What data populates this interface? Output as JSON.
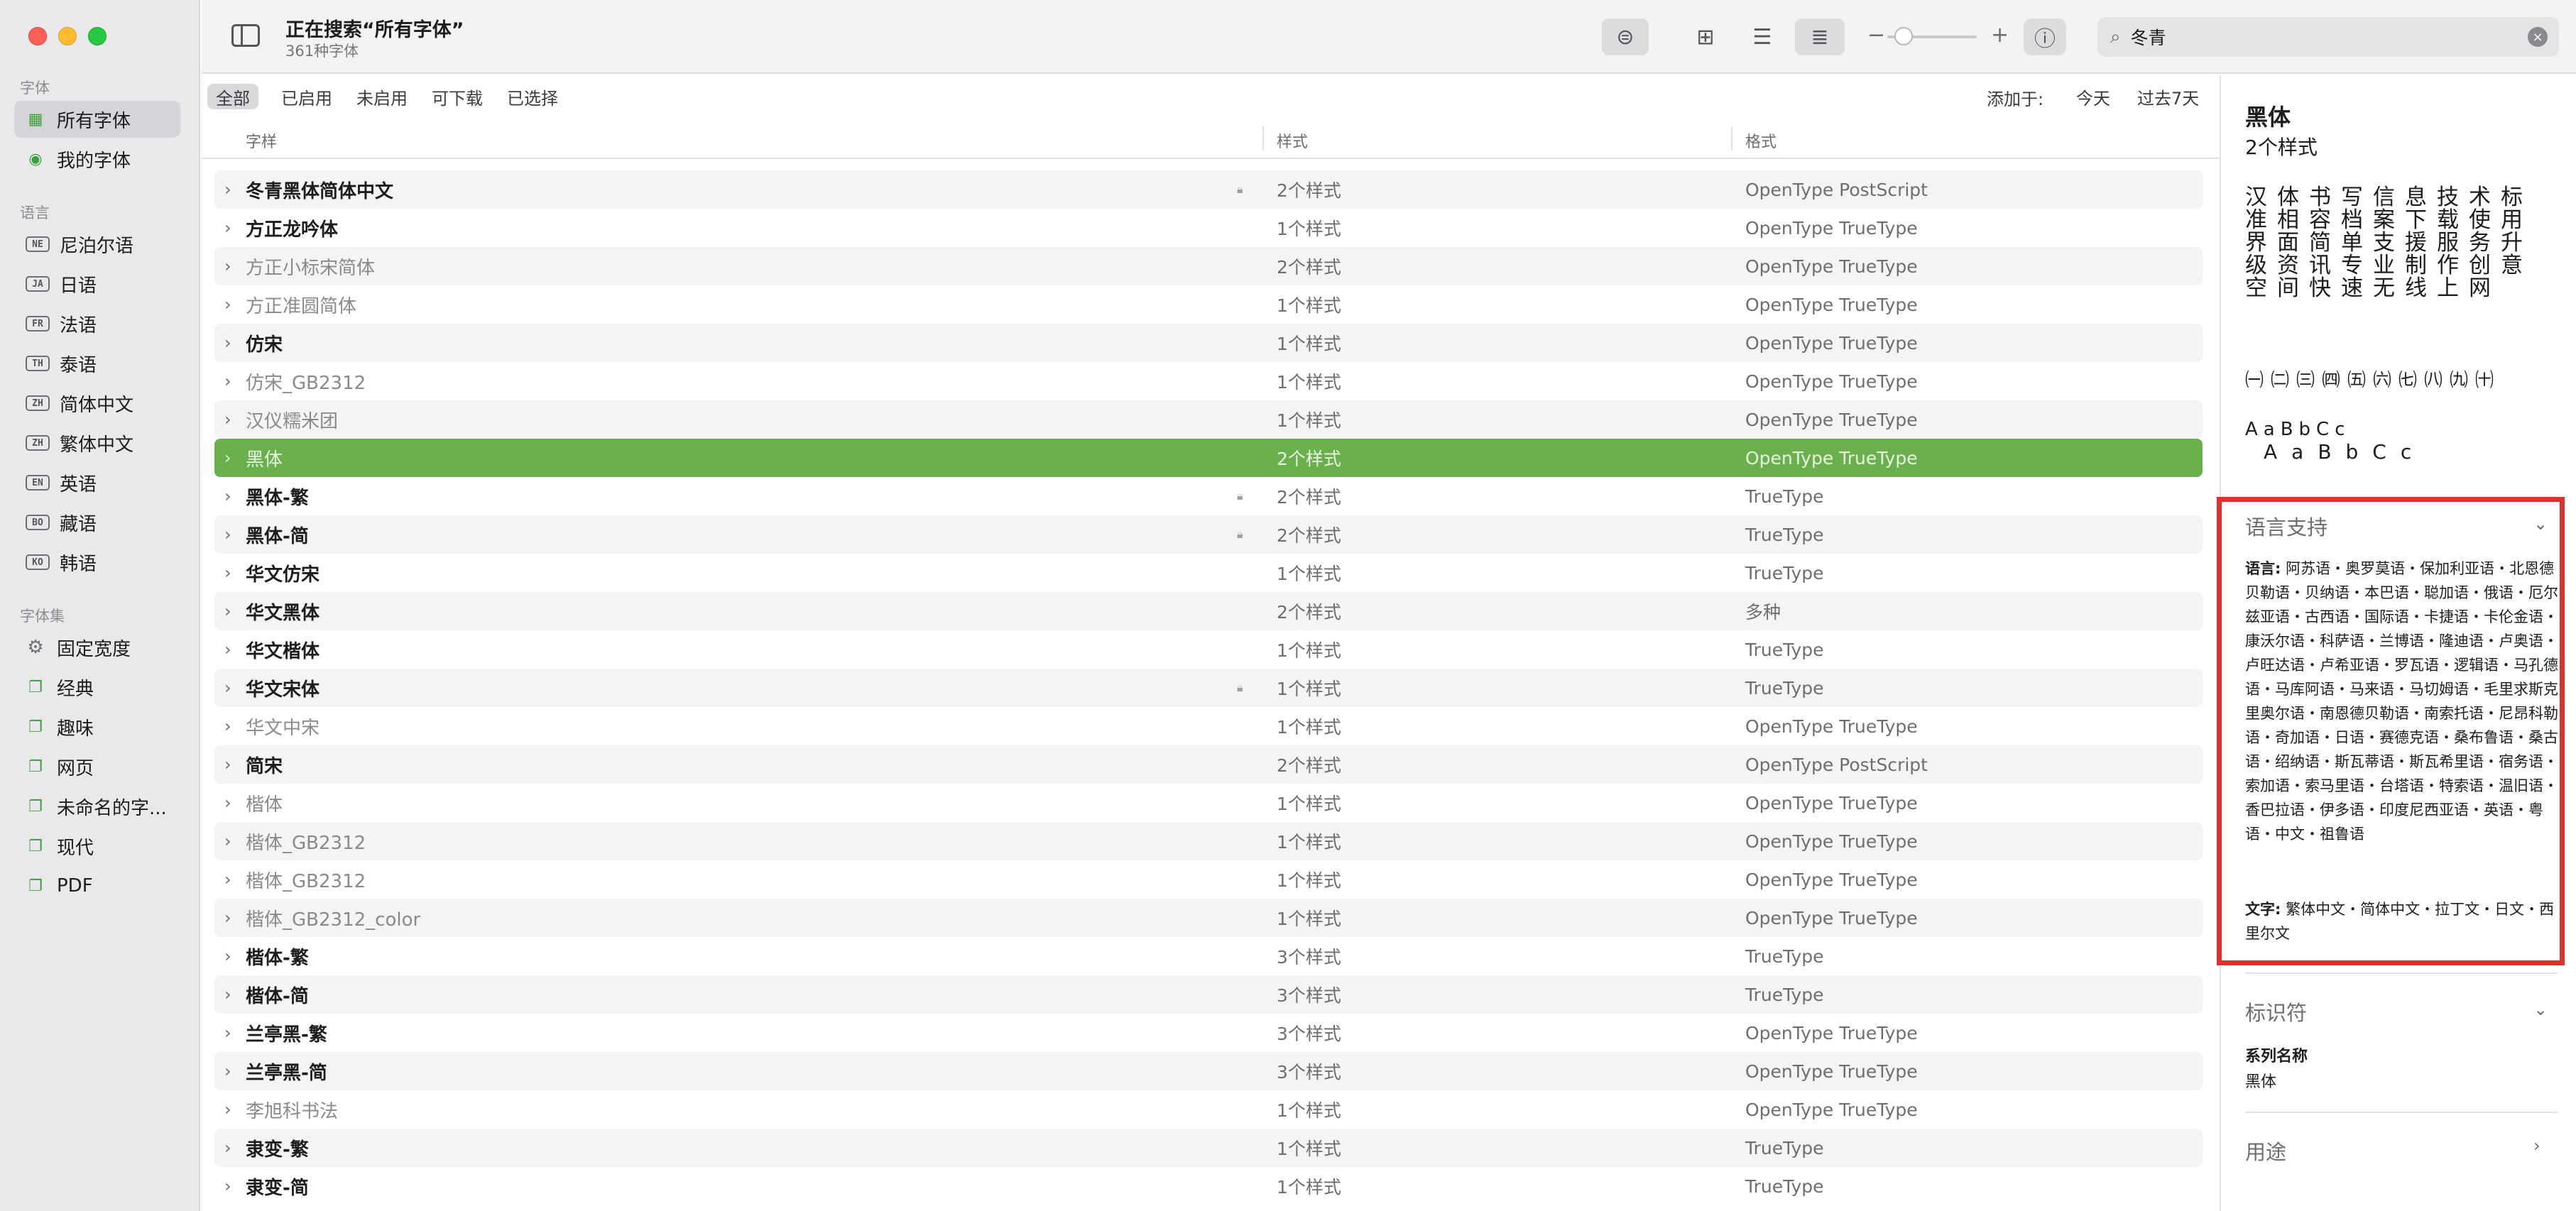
{
  "window": {
    "title": "正在搜索“所有字体”",
    "subtitle": "361种字体"
  },
  "sidebar": {
    "fonts_header": "字体",
    "items": [
      {
        "label": "所有字体",
        "icon": "grid-icon"
      },
      {
        "label": "我的字体",
        "icon": "person-icon"
      }
    ],
    "languages_header": "语言",
    "languages": [
      {
        "code": "NE",
        "label": "尼泊尔语"
      },
      {
        "code": "JA",
        "label": "日语"
      },
      {
        "code": "FR",
        "label": "法语"
      },
      {
        "code": "TH",
        "label": "泰语"
      },
      {
        "code": "ZH",
        "label": "简体中文"
      },
      {
        "code": "ZH",
        "label": "繁体中文"
      },
      {
        "code": "EN",
        "label": "英语"
      },
      {
        "code": "BO",
        "label": "藏语"
      },
      {
        "code": "KO",
        "label": "韩语"
      }
    ],
    "collections_header": "字体集",
    "collections": [
      {
        "label": "固定宽度",
        "icon": "gear-icon"
      },
      {
        "label": "经典",
        "icon": "collection-icon"
      },
      {
        "label": "趣味",
        "icon": "collection-icon"
      },
      {
        "label": "网页",
        "icon": "collection-icon"
      },
      {
        "label": "未命名的字...",
        "icon": "collection-icon"
      },
      {
        "label": "现代",
        "icon": "collection-icon"
      },
      {
        "label": "PDF",
        "icon": "collection-icon"
      }
    ]
  },
  "toolbar": {
    "zoom_minus": "−",
    "zoom_plus": "+"
  },
  "search": {
    "value": "冬青",
    "clear_symbol": "×"
  },
  "filters": {
    "tabs": [
      "全部",
      "已启用",
      "未启用",
      "可下载",
      "已选择"
    ],
    "selected_index": 0,
    "added_label": "添加于:",
    "today": "今天",
    "last7": "过去7天"
  },
  "table": {
    "headers": {
      "name": "字样",
      "styles": "样式",
      "format": "格式"
    },
    "rows": [
      {
        "name": "冬青黑体简体中文",
        "bold": true,
        "lock": true,
        "styles": "2个样式",
        "format": "OpenType PostScript"
      },
      {
        "name": "方正龙吟体",
        "bold": true,
        "lock": false,
        "styles": "1个样式",
        "format": "OpenType TrueType"
      },
      {
        "name": "方正小标宋简体",
        "bold": false,
        "lock": false,
        "styles": "2个样式",
        "format": "OpenType TrueType"
      },
      {
        "name": "方正准圆简体",
        "bold": false,
        "lock": false,
        "styles": "1个样式",
        "format": "OpenType TrueType"
      },
      {
        "name": "仿宋",
        "bold": true,
        "lock": false,
        "styles": "1个样式",
        "format": "OpenType TrueType"
      },
      {
        "name": "仿宋_GB2312",
        "bold": false,
        "lock": false,
        "styles": "1个样式",
        "format": "OpenType TrueType"
      },
      {
        "name": "汉仪糯米团",
        "bold": false,
        "lock": false,
        "styles": "1个样式",
        "format": "OpenType TrueType"
      },
      {
        "name": "黑体",
        "bold": false,
        "lock": false,
        "styles": "2个样式",
        "format": "OpenType TrueType",
        "selected": true
      },
      {
        "name": "黑体-繁",
        "bold": true,
        "lock": true,
        "styles": "2个样式",
        "format": "TrueType"
      },
      {
        "name": "黑体-简",
        "bold": true,
        "lock": true,
        "styles": "2个样式",
        "format": "TrueType"
      },
      {
        "name": "华文仿宋",
        "bold": true,
        "lock": false,
        "styles": "1个样式",
        "format": "TrueType"
      },
      {
        "name": "华文黑体",
        "bold": true,
        "lock": false,
        "styles": "2个样式",
        "format": "多种"
      },
      {
        "name": "华文楷体",
        "bold": true,
        "lock": false,
        "styles": "1个样式",
        "format": "TrueType"
      },
      {
        "name": "华文宋体",
        "bold": true,
        "lock": true,
        "styles": "1个样式",
        "format": "TrueType"
      },
      {
        "name": "华文中宋",
        "bold": false,
        "lock": false,
        "styles": "1个样式",
        "format": "OpenType TrueType"
      },
      {
        "name": "简宋",
        "bold": true,
        "lock": false,
        "styles": "2个样式",
        "format": "OpenType PostScript"
      },
      {
        "name": "楷体",
        "bold": false,
        "lock": false,
        "styles": "1个样式",
        "format": "OpenType TrueType"
      },
      {
        "name": "楷体_GB2312",
        "bold": false,
        "lock": false,
        "styles": "1个样式",
        "format": "OpenType TrueType"
      },
      {
        "name": "楷体_GB2312",
        "bold": false,
        "lock": false,
        "styles": "1个样式",
        "format": "OpenType TrueType"
      },
      {
        "name": "楷体_GB2312_color",
        "bold": false,
        "lock": false,
        "styles": "1个样式",
        "format": "OpenType TrueType"
      },
      {
        "name": "楷体-繁",
        "bold": true,
        "lock": false,
        "styles": "3个样式",
        "format": "TrueType"
      },
      {
        "name": "楷体-简",
        "bold": true,
        "lock": false,
        "styles": "3个样式",
        "format": "TrueType"
      },
      {
        "name": "兰亭黑-繁",
        "bold": true,
        "lock": false,
        "styles": "3个样式",
        "format": "OpenType TrueType"
      },
      {
        "name": "兰亭黑-简",
        "bold": true,
        "lock": false,
        "styles": "3个样式",
        "format": "OpenType TrueType"
      },
      {
        "name": "李旭科书法",
        "bold": false,
        "lock": false,
        "styles": "1个样式",
        "format": "OpenType TrueType"
      },
      {
        "name": "隶变-繁",
        "bold": true,
        "lock": false,
        "styles": "1个样式",
        "format": "TrueType"
      },
      {
        "name": "隶变-简",
        "bold": true,
        "lock": false,
        "styles": "1个样式",
        "format": "TrueType"
      }
    ]
  },
  "panel": {
    "title": "黑体",
    "subtitle": "2个样式",
    "sample_text": "汉体书写信息技术标准相容档案下载使用界面简单支援服务升级资讯专业制作创意空间快速无线上网",
    "sample_numerals": "㈠㈡㈢㈣㈤㈥㈦㈧㈨㈩",
    "sample_latin_1": "AaBbCc",
    "sample_latin_2": "AaBbCc",
    "language_support_title": "语言支持",
    "languages_label": "语言:",
    "languages_value": "阿苏语・奥罗莫语・保加利亚语・北恩德贝勒语・贝纳语・本巴语・聪加语・俄语・厄尔兹亚语・古西语・国际语・卡捷语・卡伦金语・康沃尔语・科萨语・兰博语・隆迪语・卢奥语・卢旺达语・卢希亚语・罗瓦语・逻辑语・马孔德语・马库阿语・马来语・马切姆语・毛里求斯克里奥尔语・南恩德贝勒语・南索托语・尼昂科勒语・奇加语・日语・赛德克语・桑布鲁语・桑古语・绍纳语・斯瓦蒂语・斯瓦希里语・宿务语・索加语・索马里语・台塔语・特索语・温旧语・香巴拉语・伊多语・印度尼西亚语・英语・粤语・中文・祖鲁语",
    "scripts_label": "文字:",
    "scripts_value": "繁体中文・简体中文・拉丁文・日文・西里尔文",
    "identifier_title": "标识符",
    "family_name_label": "系列名称",
    "family_name_value": "黑体",
    "usage_title": "用途"
  },
  "colors": {
    "selection_green": "#6ab04c",
    "highlight_red": "#e0302c",
    "sidebar_bg": "#e9e8ea"
  }
}
